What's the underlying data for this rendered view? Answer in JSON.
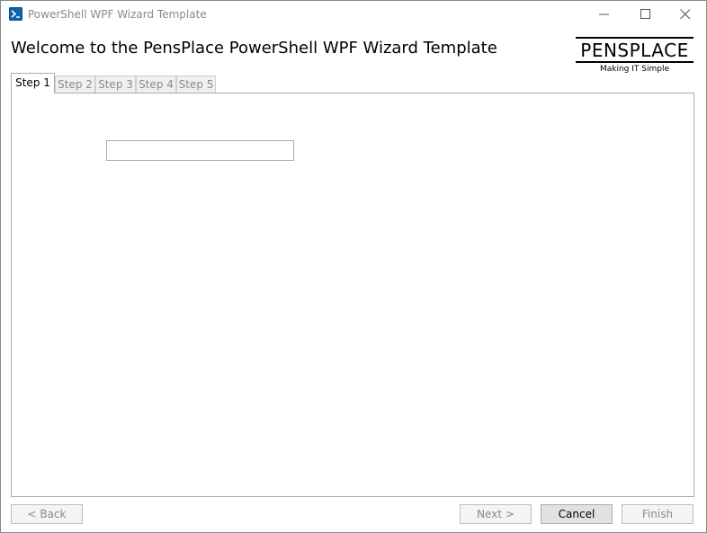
{
  "window": {
    "title": "PowerShell WPF Wizard Template",
    "icon": "powershell-icon",
    "controls": [
      "minimize-icon",
      "maximize-icon",
      "close-icon"
    ]
  },
  "header": {
    "heading": "Welcome to the PensPlace PowerShell WPF Wizard Template",
    "logo": {
      "word": "PENSPLACE",
      "tagline": "Making IT Simple"
    }
  },
  "tabs": [
    {
      "label": "Step 1",
      "active": true
    },
    {
      "label": "Step 2",
      "active": false
    },
    {
      "label": "Step 3",
      "active": false
    },
    {
      "label": "Step 4",
      "active": false
    },
    {
      "label": "Step 5",
      "active": false
    }
  ],
  "step1": {
    "text_field": {
      "value": "",
      "placeholder": ""
    }
  },
  "footer": {
    "back_label": "< Back",
    "next_label": "Next >",
    "cancel_label": "Cancel",
    "finish_label": "Finish"
  },
  "colors": {
    "disabled_text": "#8a8a8a",
    "powershell_blue": "#0b62ad"
  }
}
